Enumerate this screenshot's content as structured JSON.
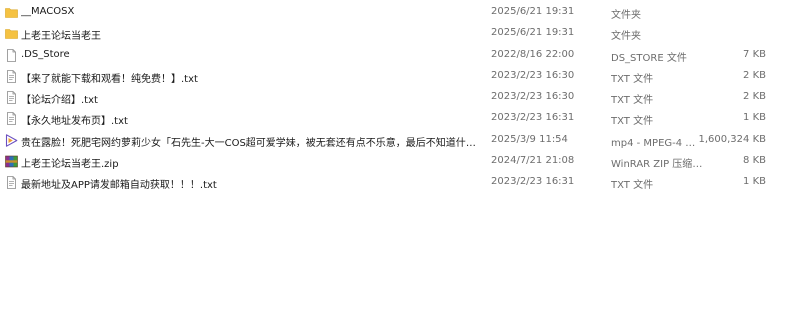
{
  "files": [
    {
      "name": "__MACOSX",
      "date": "2025/6/21 19:31",
      "type": "文件夹",
      "size": "",
      "icon": "folder-icon"
    },
    {
      "name": "上老王论坛当老王",
      "date": "2025/6/21 19:31",
      "type": "文件夹",
      "size": "",
      "icon": "folder-icon"
    },
    {
      "name": ".DS_Store",
      "date": "2022/8/16 22:00",
      "type": "DS_STORE 文件",
      "size": "7 KB",
      "icon": "file-icon"
    },
    {
      "name": "【来了就能下载和观看！纯免费！】.txt",
      "date": "2023/2/23 16:30",
      "type": "TXT 文件",
      "size": "2 KB",
      "icon": "text-file-icon"
    },
    {
      "name": "【论坛介绍】.txt",
      "date": "2023/2/23 16:30",
      "type": "TXT 文件",
      "size": "2 KB",
      "icon": "text-file-icon"
    },
    {
      "name": "【永久地址发布页】.txt",
      "date": "2023/2/23 16:31",
      "type": "TXT 文件",
      "size": "1 KB",
      "icon": "text-file-icon"
    },
    {
      "name": "贵在露脸！死肥宅网约萝莉少女「石先生-大一COS超可爱学妹，被无套还有点不乐意，最后不知道什么原因还哭了...",
      "date": "2025/3/9 11:54",
      "type": "mp4 - MPEG-4 电影...",
      "size": "1,600,324 KB",
      "icon": "video-file-icon"
    },
    {
      "name": "上老王论坛当老王.zip",
      "date": "2024/7/21 21:08",
      "type": "WinRAR ZIP 压缩文件",
      "size": "8 KB",
      "icon": "zip-archive-icon"
    },
    {
      "name": "最新地址及APP请发邮箱自动获取！！！.txt",
      "date": "2023/2/23 16:31",
      "type": "TXT 文件",
      "size": "1 KB",
      "icon": "text-file-icon"
    }
  ],
  "colors": {
    "folder": "#f5c242",
    "text_primary": "#1a1a1a",
    "text_secondary": "#6d6d6d"
  }
}
